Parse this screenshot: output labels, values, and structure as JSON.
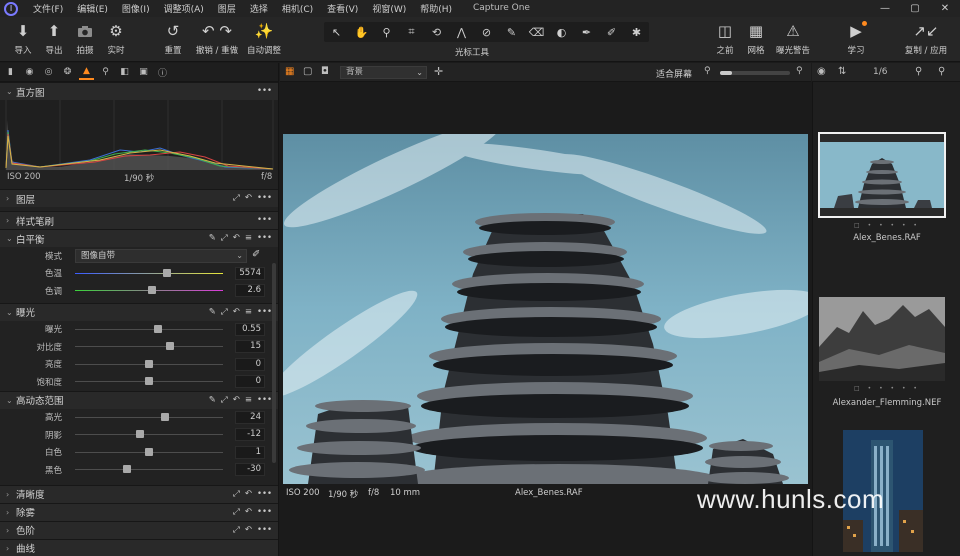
{
  "menubar": {
    "logo": "I",
    "items": [
      "文件(F)",
      "编辑(E)",
      "图像(I)",
      "调整项(A)",
      "图层",
      "选择",
      "相机(C)",
      "查看(V)",
      "视窗(W)",
      "帮助(H)"
    ],
    "app_title": "Capture One",
    "controls": [
      "—",
      "▢",
      "✕"
    ]
  },
  "toolbar": {
    "import": "导入",
    "export": "导出",
    "capture": "拍摄",
    "live": "实时",
    "reset": "重置",
    "undo_redo": "撤销 / 重做",
    "auto_adjust": "自动调整",
    "cursor_tools_label": "光标工具",
    "before": "之前",
    "grid": "网格",
    "exposure_warning": "曝光警告",
    "learn": "学习",
    "copy_apply": "复制 / 应用"
  },
  "histogram": {
    "title": "直方图",
    "iso": "ISO 200",
    "shutter": "1/90 秒",
    "aperture": "f/8"
  },
  "layers": {
    "title": "图层"
  },
  "styles": {
    "title": "样式笔刷"
  },
  "white_balance": {
    "title": "白平衡",
    "mode_label": "模式",
    "mode_value": "图像自带",
    "temp_label": "色温",
    "temp_value": "5574",
    "tint_label": "色调",
    "tint_value": "2.6"
  },
  "exposure": {
    "title": "曝光",
    "rows": [
      {
        "label": "曝光",
        "value": "0.55"
      },
      {
        "label": "对比度",
        "value": "15"
      },
      {
        "label": "亮度",
        "value": "0"
      },
      {
        "label": "饱和度",
        "value": "0"
      }
    ]
  },
  "hdr": {
    "title": "高动态范围",
    "rows": [
      {
        "label": "高光",
        "value": "24"
      },
      {
        "label": "阴影",
        "value": "-12"
      },
      {
        "label": "白色",
        "value": "1"
      },
      {
        "label": "黑色",
        "value": "-30"
      }
    ]
  },
  "clarity": {
    "title": "清晰度"
  },
  "dehaze": {
    "title": "除雾"
  },
  "levels": {
    "title": "色阶"
  },
  "curves": {
    "title": "曲线"
  },
  "viewer": {
    "layer_select": "背景",
    "fit_label": "适合屏幕",
    "info_iso": "ISO 200",
    "info_shutter": "1/90 秒",
    "info_aperture": "f/8",
    "info_focal": "10 mm",
    "info_filename": "Alex_Benes.RAF"
  },
  "browser": {
    "counter": "1/6",
    "thumbs": [
      {
        "name": "Alex_Benes.RAF"
      },
      {
        "name": "Alexander_Flemming.NEF"
      }
    ]
  },
  "watermark": "www.hunls.com",
  "colors": {
    "accent": "#ff8a1f"
  }
}
